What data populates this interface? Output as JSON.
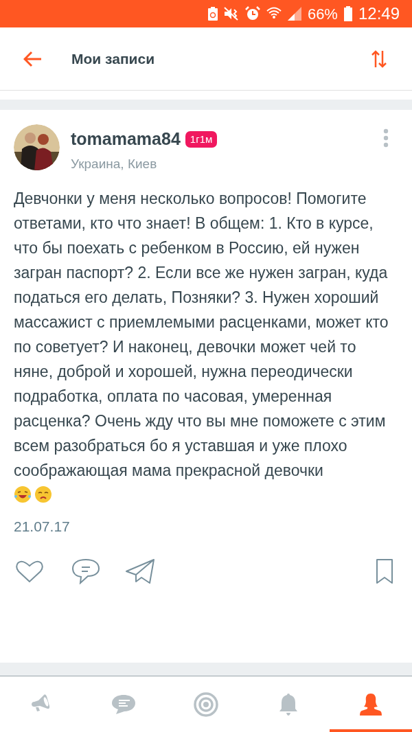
{
  "status_bar": {
    "battery": "66%",
    "time": "12:49"
  },
  "header": {
    "title": "Мои записи"
  },
  "post": {
    "author": "tomamama84",
    "badge": "1г1м",
    "location": "Украина, Киев",
    "text": "Девчонки у меня несколько вопросов! Помогите ответами, кто что знает! В общем: 1. Кто в курсе, что бы поехать с ребенком в Россию, ей нужен загран паспорт? 2. Если все же нужен загран, куда податься его делать, Позняки? 3. Нужен хороший массажист с приемлемыми расценками, может кто по советует? И наконец, девочки может чей то няне,  доброй и хорошей, нужна переодически подработка, оплата по часовая, умеренная расценка? Очень жду что вы мне поможете с этим всем разобраться бо я уставшая и уже плохо соображающая мама прекрасной девочки",
    "date": "21.07.17"
  },
  "bottom_nav": [
    {
      "kind": "feed",
      "selected": false
    },
    {
      "kind": "messages",
      "selected": false
    },
    {
      "kind": "target",
      "selected": false
    },
    {
      "kind": "notifications",
      "selected": false
    },
    {
      "kind": "profile",
      "selected": true
    }
  ]
}
